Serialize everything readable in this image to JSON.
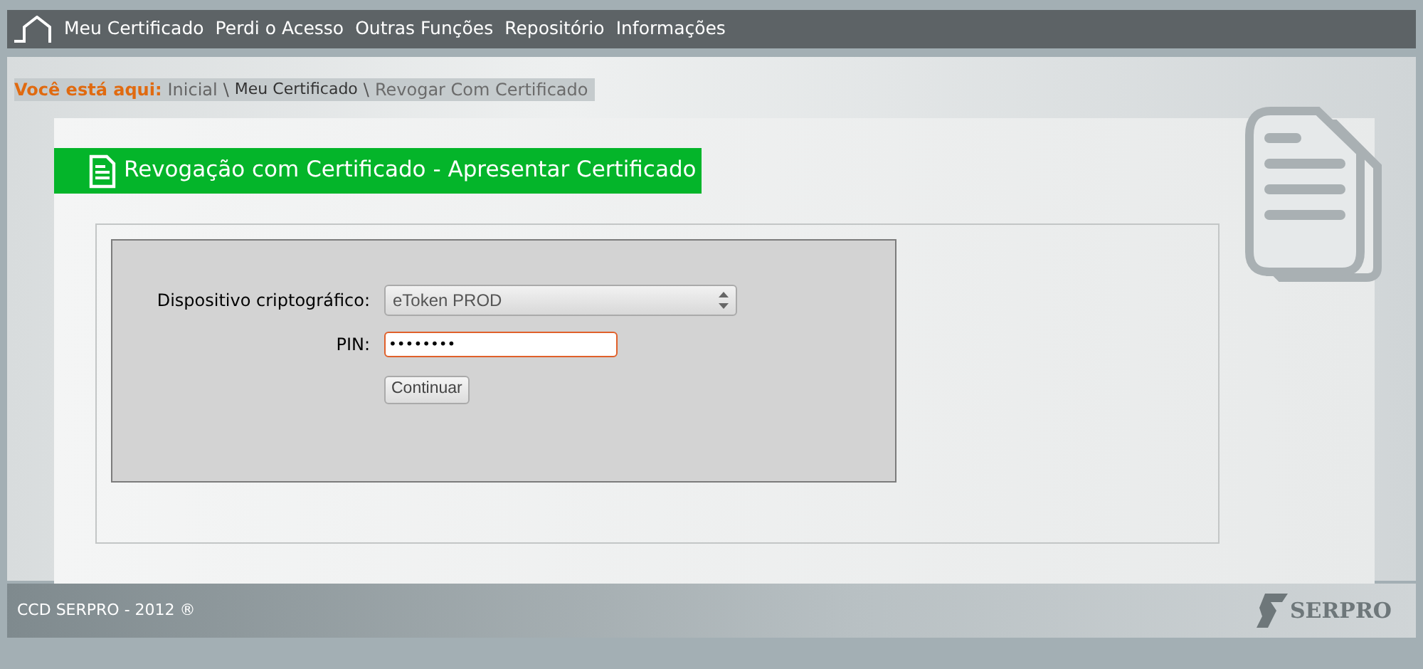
{
  "nav": {
    "items": [
      {
        "label": "Meu Certificado"
      },
      {
        "label": "Perdi o Acesso"
      },
      {
        "label": "Outras Funções"
      },
      {
        "label": "Repositório"
      },
      {
        "label": "Informações"
      }
    ]
  },
  "breadcrumb": {
    "prefix": "Você está aqui:",
    "items": [
      {
        "label": "Inicial"
      },
      {
        "label": "Meu Certificado"
      },
      {
        "label": "Revogar Com Certificado"
      }
    ],
    "separator": "\\"
  },
  "page_title": "Revogação com Certificado - Apresentar Certificado",
  "form": {
    "device_label": "Dispositivo criptográfico:",
    "device_value": "eToken PROD",
    "pin_label": "PIN:",
    "pin_value": "••••••••",
    "submit": "Continuar"
  },
  "footer": {
    "copyright": "CCD SERPRO - 2012 ®",
    "logo": "SERPRO"
  }
}
